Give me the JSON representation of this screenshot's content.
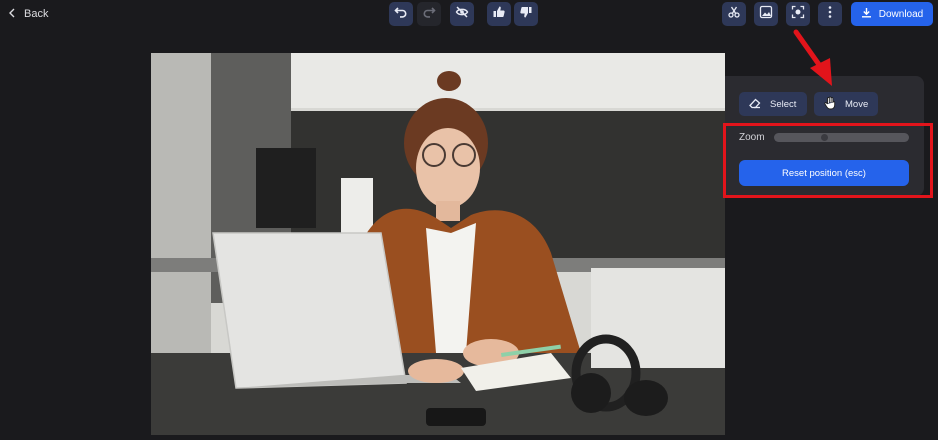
{
  "topbar": {
    "back_label": "Back",
    "download_label": "Download"
  },
  "tools": {
    "undo": "undo-icon",
    "redo": "redo-icon",
    "hide": "eye-off-icon",
    "like": "thumbs-up-icon",
    "dislike": "thumbs-down-icon",
    "right_tools": [
      "tools-icon",
      "image-edit-icon",
      "focus-icon",
      "more-vertical-icon"
    ]
  },
  "panel": {
    "select_label": "Select",
    "move_label": "Move",
    "zoom_label": "Zoom",
    "zoom_level": 0.37,
    "reset_label": "Reset position (esc)"
  },
  "colors": {
    "background": "#1a1a1d",
    "accent": "#2563eb",
    "tool_button": "#2e3858",
    "panel": "#2b2b30",
    "annotation": "#e2141b"
  }
}
